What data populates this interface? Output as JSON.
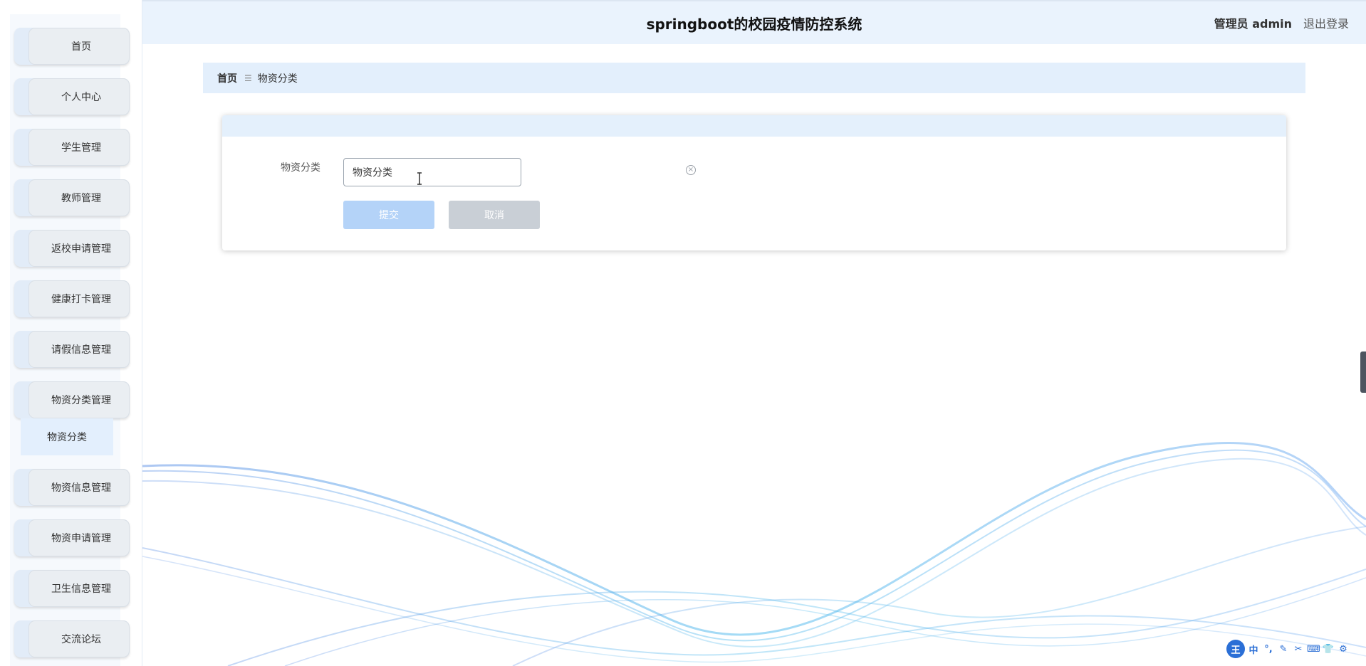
{
  "app": {
    "title": "springboot的校园疫情防控系统",
    "user_label": "管理员 admin",
    "logout_label": "退出登录"
  },
  "sidebar": {
    "items": [
      {
        "label": "首页"
      },
      {
        "label": "个人中心"
      },
      {
        "label": "学生管理"
      },
      {
        "label": "教师管理"
      },
      {
        "label": "返校申请管理"
      },
      {
        "label": "健康打卡管理"
      },
      {
        "label": "请假信息管理"
      },
      {
        "label": "物资分类管理"
      },
      {
        "label": "物资信息管理"
      },
      {
        "label": "物资申请管理"
      },
      {
        "label": "卫生信息管理"
      },
      {
        "label": "交流论坛"
      }
    ],
    "active_sub": {
      "label": "物资分类"
    }
  },
  "breadcrumb": {
    "home": "首页",
    "separator": "☰",
    "current": "物资分类"
  },
  "form": {
    "field_label": "物资分类",
    "field_value": "物资分类",
    "clear_symbol": "×",
    "submit_label": "提交",
    "cancel_label": "取消"
  },
  "ime": {
    "logo": "王",
    "buttons": [
      "中",
      "°,",
      "✎",
      "✂",
      "⌨",
      "👕",
      "⚙"
    ]
  },
  "colors": {
    "header_bg": "#eaf3fd",
    "breadcrumb_bg": "#e3effc",
    "submit_bg": "#b4d3f8",
    "cancel_bg": "#c9cfd6",
    "wave": "#4aa3e8"
  }
}
